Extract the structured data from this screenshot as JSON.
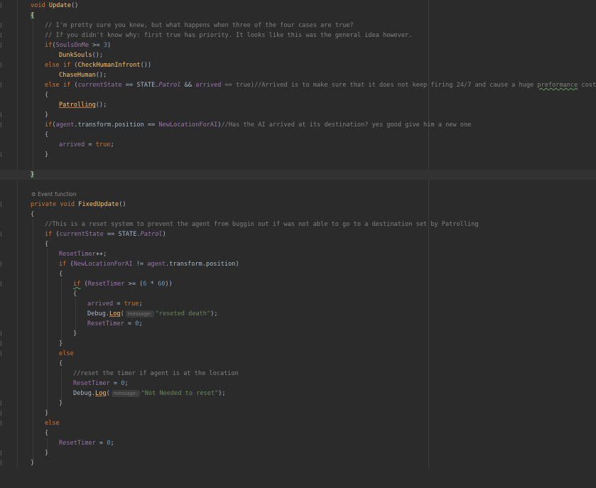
{
  "colors": {
    "background": "#2b2b2b",
    "keyword": "#cc7832",
    "method": "#ffc66d",
    "number": "#6897bb",
    "string": "#6a8759",
    "comment": "#808080",
    "field": "#9876aa"
  },
  "code": {
    "l1_kw": "void",
    "l1_fn": "Update",
    "l1_rest": "()",
    "l2_brace": "{",
    "l3_comment": "// I'm pretty sure you knew, but what happens when three of the four cases are true?",
    "l4_comment": "// If you didn't know why: first true has priority. It looks like this was the general idea however.",
    "l5_kw": "if",
    "l5_a": "(",
    "l5_fld": "SoulsOnMe",
    "l5_b": " >= ",
    "l5_num": "3",
    "l5_c": ")",
    "l6_fn": "DunkSouls",
    "l6_rest": "();",
    "l7_kw1": "else",
    "l7_kw2": "if",
    "l7_a": " (",
    "l7_fn": "CheckHumanInfront",
    "l7_b": "())",
    "l8_fn": "ChaseHuman",
    "l8_rest": "();",
    "l9_kw1": "else",
    "l9_kw2": "if",
    "l9_a": " (",
    "l9_fld": "currentState",
    "l9_b": " == ",
    "l9_c": "STATE.",
    "l9_en": "Patrol",
    "l9_d": " && ",
    "l9_fld2": "arrived",
    "l9_e": " == ",
    "l9_kw3": "true",
    "l9_f": ")",
    "l9_comment1": "//Arrived is to make sure that it does not keep firing 24/7 and cause a huge ",
    "l9_comment_typo": "preformance",
    "l9_comment2": " cost",
    "l10_brace": "{",
    "l11_fn": "Patrolling",
    "l11_rest": "();",
    "l12_brace": "}",
    "l13_kw": "if",
    "l13_a": "(",
    "l13_fld": "agent",
    "l13_b": ".",
    "l13_c": "transform",
    "l13_d": ".",
    "l13_e": "position",
    "l13_f": " == ",
    "l13_fld2": "NewLocationForAI",
    "l13_g": ")",
    "l13_comment": "//Has the AI arrived at its destination? yes good give him a new one",
    "l14_brace": "{",
    "l15_fld": "arrived",
    "l15_a": " = ",
    "l15_kw": "true",
    "l15_b": ";",
    "l16_brace": "}",
    "l17_brace": "}",
    "event_function": "Event function",
    "l18_kw1": "private",
    "l18_kw2": "void",
    "l18_fn": "FixedUpdate",
    "l18_rest": "()",
    "l19_brace": "{",
    "l20_comment": "//This is a reset system to prevent the agent from buggin out if was not able to go to a destination set by Patrolling",
    "l21_kw": "if",
    "l21_a": " (",
    "l21_fld": "currentState",
    "l21_b": " == ",
    "l21_c": "STATE.",
    "l21_en": "Patrol",
    "l21_d": ")",
    "l22_brace": "{",
    "l23_fld": "ResetTimer",
    "l23_rest": "++;",
    "l24_kw": "if",
    "l24_a": " (",
    "l24_fld": "NewLocationForAI",
    "l24_b": " != ",
    "l24_fld2": "agent",
    "l24_c": ".",
    "l24_d": "transform",
    "l24_e": ".",
    "l24_f": "position",
    "l24_g": ")",
    "l25_brace": "{",
    "l26_kw": "if",
    "l26_a": " (",
    "l26_fld": "ResetTimer",
    "l26_b": " >= (",
    "l26_num1": "6",
    "l26_c": " * ",
    "l26_num2": "60",
    "l26_d": "))",
    "l27_brace": "{",
    "l28_fld": "arrived",
    "l28_a": " = ",
    "l28_kw": "true",
    "l28_b": ";",
    "l29_a": "Debug.",
    "l29_fn": "Log",
    "l29_b": "(",
    "l29_hint": "message:",
    "l29_str": "\"reseted death\"",
    "l29_c": ");",
    "l30_fld": "ResetTimer",
    "l30_a": " = ",
    "l30_num": "0",
    "l30_b": ";",
    "l31_brace": "}",
    "l32_brace": "}",
    "l33_kw": "else",
    "l34_brace": "{",
    "l35_comment": "//reset the timer if agent is at the location",
    "l36_fld": "ResetTimer",
    "l36_a": " = ",
    "l36_num": "0",
    "l36_b": ";",
    "l37_a": "Debug.",
    "l37_fn": "Log",
    "l37_b": "(",
    "l37_hint": "message:",
    "l37_str": "\"Not Needed to reset\"",
    "l37_c": ");",
    "l38_brace": "}",
    "l39_brace": "}",
    "l40_kw": "else",
    "l41_brace": "{",
    "l42_fld": "ResetTimer",
    "l42_a": " = ",
    "l42_num": "0",
    "l42_b": ";",
    "l43_brace": "}",
    "l44_brace": "}"
  }
}
